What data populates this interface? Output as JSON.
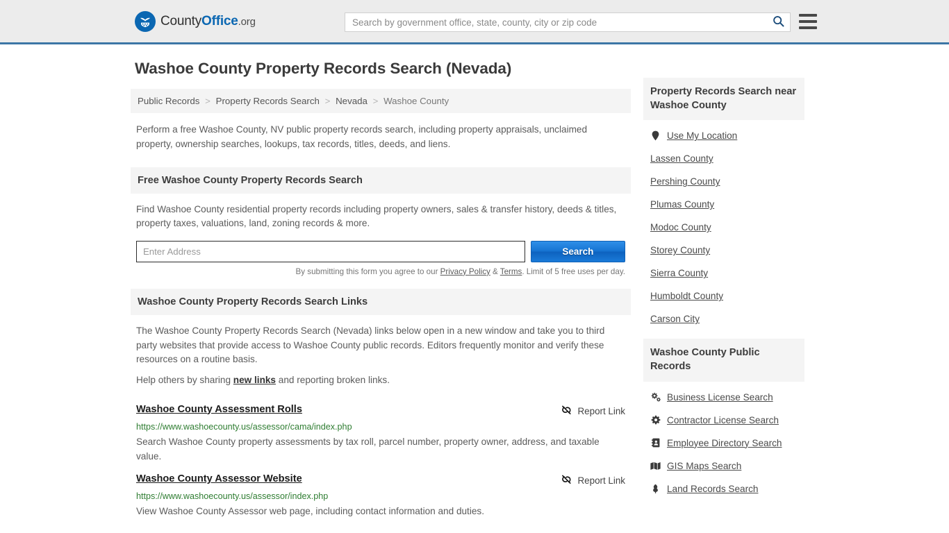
{
  "header": {
    "logo": {
      "icon": "eagle-shield-icon",
      "text_part1": "County",
      "text_part2": "Office",
      "text_part3": ".org"
    },
    "search": {
      "placeholder": "Search by government office, state, county, city or zip code",
      "value": "",
      "search_icon": "search-icon"
    },
    "menu_icon": "hamburger-menu-icon",
    "accent_color": "#3c76a5"
  },
  "page": {
    "title": "Washoe County Property Records Search (Nevada)",
    "breadcrumb": [
      {
        "label": "Public Records",
        "current": false
      },
      {
        "label": "Property Records Search",
        "current": false
      },
      {
        "label": "Nevada",
        "current": false
      },
      {
        "label": "Washoe County",
        "current": true
      }
    ],
    "breadcrumb_separator": ">",
    "intro": "Perform a free Washoe County, NV public property records search, including property appraisals, unclaimed property, ownership searches, lookups, tax records, titles, deeds, and liens."
  },
  "free_search": {
    "heading": "Free Washoe County Property Records Search",
    "body": "Find Washoe County residential property records including property owners, sales & transfer history, deeds & titles, property taxes, valuations, land, zoning records & more.",
    "input_placeholder": "Enter Address",
    "input_value": "",
    "submit_label": "Search",
    "disclaimer_prefix": "By submitting this form you agree to our ",
    "privacy_label": "Privacy Policy",
    "disclaimer_amp": " & ",
    "terms_label": "Terms",
    "disclaimer_suffix": ". Limit of 5 free uses per day.",
    "button_color": "#1573d2"
  },
  "links_section": {
    "heading": "Washoe County Property Records Search Links",
    "paragraph": "The Washoe County Property Records Search (Nevada) links below open in a new window and take you to third party websites that provide access to Washoe County public records. Editors frequently monitor and verify these resources on a routine basis.",
    "help_prefix": "Help others by sharing ",
    "help_link": "new links",
    "help_suffix": " and reporting broken links.",
    "report_label": "Report Link",
    "report_icon": "broken-link-icon",
    "items": [
      {
        "title": "Washoe County Assessment Rolls",
        "url": "https://www.washoecounty.us/assessor/cama/index.php",
        "description": "Search Washoe County property assessments by tax roll, parcel number, property owner, address, and taxable value."
      },
      {
        "title": "Washoe County Assessor Website",
        "url": "https://www.washoecounty.us/assessor/index.php",
        "description": "View Washoe County Assessor web page, including contact information and duties."
      }
    ]
  },
  "sidebar": {
    "nearby": {
      "heading": "Property Records Search near Washoe County",
      "items": [
        {
          "label": "Use My Location",
          "icon": "map-pin-icon"
        },
        {
          "label": "Lassen County",
          "icon": ""
        },
        {
          "label": "Pershing County",
          "icon": ""
        },
        {
          "label": "Plumas County",
          "icon": ""
        },
        {
          "label": "Modoc County",
          "icon": ""
        },
        {
          "label": "Storey County",
          "icon": ""
        },
        {
          "label": "Sierra County",
          "icon": ""
        },
        {
          "label": "Humboldt County",
          "icon": ""
        },
        {
          "label": "Carson City",
          "icon": ""
        }
      ]
    },
    "public_records": {
      "heading": "Washoe County Public Records",
      "items": [
        {
          "label": "Business License Search",
          "icon": "cogs-icon"
        },
        {
          "label": "Contractor License Search",
          "icon": "cog-icon"
        },
        {
          "label": "Employee Directory Search",
          "icon": "address-book-icon"
        },
        {
          "label": "GIS Maps Search",
          "icon": "map-icon"
        },
        {
          "label": "Land Records Search",
          "icon": "landmark-icon"
        }
      ]
    }
  }
}
